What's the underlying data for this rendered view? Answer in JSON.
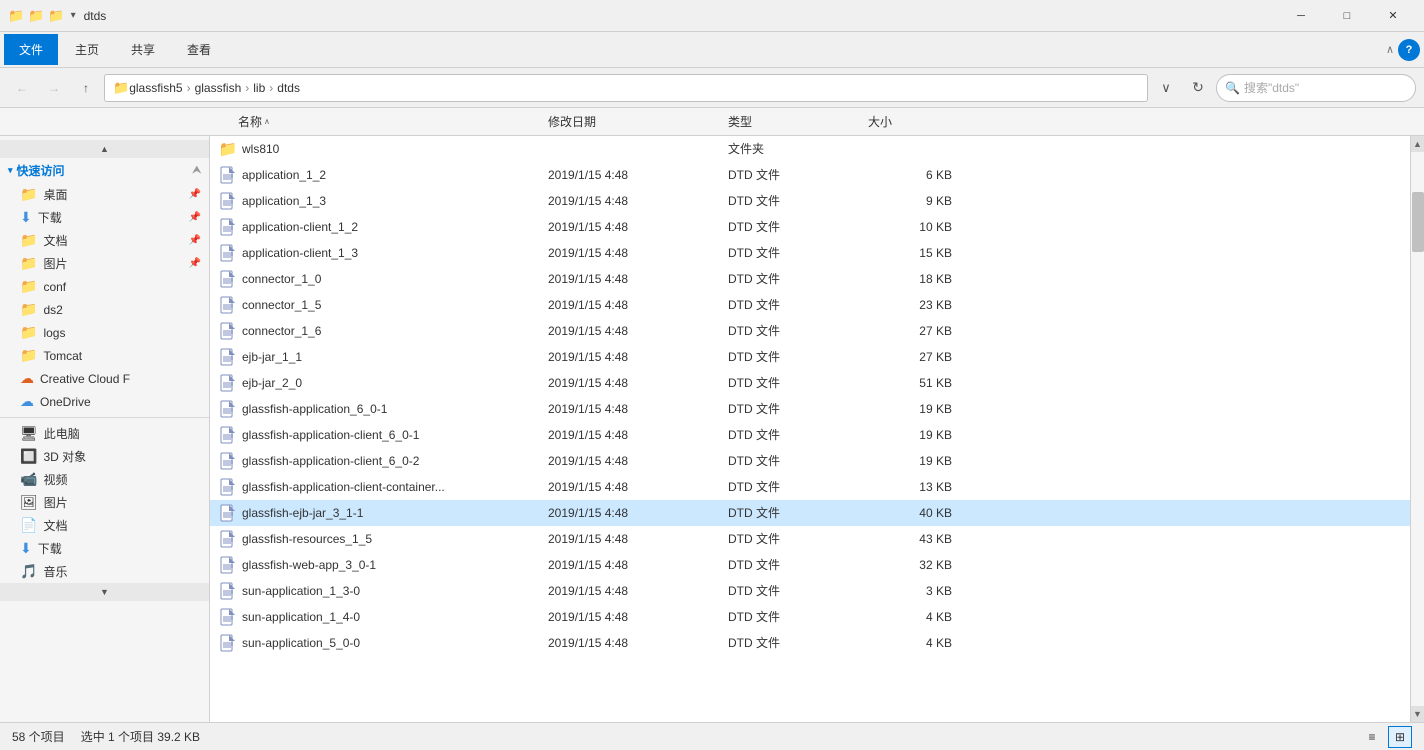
{
  "titlebar": {
    "title": "dtds",
    "icons": [
      "folder-yellow",
      "folder-blue",
      "folder-yellow"
    ],
    "min_label": "─",
    "max_label": "□",
    "close_label": "✕"
  },
  "ribbon": {
    "tabs": [
      "文件",
      "主页",
      "共享",
      "查看"
    ],
    "active_tab": "文件"
  },
  "addressbar": {
    "back_disabled": true,
    "forward_disabled": true,
    "up_label": "↑",
    "breadcrumbs": [
      "glassfish5",
      "glassfish",
      "lib",
      "dtds"
    ],
    "search_placeholder": "搜索\"dtds\"",
    "chevron_down": "∨",
    "refresh_label": "⟳"
  },
  "columns": {
    "name": "名称",
    "date": "修改日期",
    "type": "类型",
    "size": "大小",
    "sort_arrow": "∧"
  },
  "sidebar": {
    "quick_access_label": "快速访问",
    "items": [
      {
        "label": "桌面",
        "icon": "📁",
        "pinned": true
      },
      {
        "label": "下载",
        "icon": "📥",
        "pinned": true
      },
      {
        "label": "文档",
        "icon": "📁",
        "pinned": true
      },
      {
        "label": "图片",
        "icon": "📁",
        "pinned": true
      },
      {
        "label": "conf",
        "icon": "📁",
        "pinned": false
      },
      {
        "label": "ds2",
        "icon": "📁",
        "pinned": false
      },
      {
        "label": "logs",
        "icon": "📁",
        "pinned": false
      },
      {
        "label": "Tomcat",
        "icon": "📁",
        "pinned": false
      },
      {
        "label": "Creative Cloud F",
        "icon": "☁",
        "pinned": false,
        "color": "orange"
      },
      {
        "label": "OneDrive",
        "icon": "☁",
        "pinned": false,
        "color": "blue"
      },
      {
        "label": "此电脑",
        "icon": "💻",
        "pinned": false
      },
      {
        "label": "3D 对象",
        "icon": "🔲",
        "pinned": false
      },
      {
        "label": "视频",
        "icon": "📹",
        "pinned": false
      },
      {
        "label": "图片",
        "icon": "🖼",
        "pinned": false
      },
      {
        "label": "文档",
        "icon": "📄",
        "pinned": false
      },
      {
        "label": "下载",
        "icon": "📥",
        "pinned": false
      },
      {
        "label": "音乐",
        "icon": "🎵",
        "pinned": false
      }
    ]
  },
  "files": [
    {
      "name": "wls810",
      "date": "",
      "type": "文件夹",
      "size": "",
      "is_folder": true,
      "selected": false
    },
    {
      "name": "application_1_2",
      "date": "2019/1/15 4:48",
      "type": "DTD 文件",
      "size": "6 KB",
      "is_folder": false,
      "selected": false
    },
    {
      "name": "application_1_3",
      "date": "2019/1/15 4:48",
      "type": "DTD 文件",
      "size": "9 KB",
      "is_folder": false,
      "selected": false
    },
    {
      "name": "application-client_1_2",
      "date": "2019/1/15 4:48",
      "type": "DTD 文件",
      "size": "10 KB",
      "is_folder": false,
      "selected": false
    },
    {
      "name": "application-client_1_3",
      "date": "2019/1/15 4:48",
      "type": "DTD 文件",
      "size": "15 KB",
      "is_folder": false,
      "selected": false
    },
    {
      "name": "connector_1_0",
      "date": "2019/1/15 4:48",
      "type": "DTD 文件",
      "size": "18 KB",
      "is_folder": false,
      "selected": false
    },
    {
      "name": "connector_1_5",
      "date": "2019/1/15 4:48",
      "type": "DTD 文件",
      "size": "23 KB",
      "is_folder": false,
      "selected": false
    },
    {
      "name": "connector_1_6",
      "date": "2019/1/15 4:48",
      "type": "DTD 文件",
      "size": "27 KB",
      "is_folder": false,
      "selected": false
    },
    {
      "name": "ejb-jar_1_1",
      "date": "2019/1/15 4:48",
      "type": "DTD 文件",
      "size": "27 KB",
      "is_folder": false,
      "selected": false
    },
    {
      "name": "ejb-jar_2_0",
      "date": "2019/1/15 4:48",
      "type": "DTD 文件",
      "size": "51 KB",
      "is_folder": false,
      "selected": false
    },
    {
      "name": "glassfish-application_6_0-1",
      "date": "2019/1/15 4:48",
      "type": "DTD 文件",
      "size": "19 KB",
      "is_folder": false,
      "selected": false
    },
    {
      "name": "glassfish-application-client_6_0-1",
      "date": "2019/1/15 4:48",
      "type": "DTD 文件",
      "size": "19 KB",
      "is_folder": false,
      "selected": false
    },
    {
      "name": "glassfish-application-client_6_0-2",
      "date": "2019/1/15 4:48",
      "type": "DTD 文件",
      "size": "19 KB",
      "is_folder": false,
      "selected": false
    },
    {
      "name": "glassfish-application-client-container...",
      "date": "2019/1/15 4:48",
      "type": "DTD 文件",
      "size": "13 KB",
      "is_folder": false,
      "selected": false
    },
    {
      "name": "glassfish-ejb-jar_3_1-1",
      "date": "2019/1/15 4:48",
      "type": "DTD 文件",
      "size": "40 KB",
      "is_folder": false,
      "selected": true
    },
    {
      "name": "glassfish-resources_1_5",
      "date": "2019/1/15 4:48",
      "type": "DTD 文件",
      "size": "43 KB",
      "is_folder": false,
      "selected": false
    },
    {
      "name": "glassfish-web-app_3_0-1",
      "date": "2019/1/15 4:48",
      "type": "DTD 文件",
      "size": "32 KB",
      "is_folder": false,
      "selected": false
    },
    {
      "name": "sun-application_1_3-0",
      "date": "2019/1/15 4:48",
      "type": "DTD 文件",
      "size": "3 KB",
      "is_folder": false,
      "selected": false
    },
    {
      "name": "sun-application_1_4-0",
      "date": "2019/1/15 4:48",
      "type": "DTD 文件",
      "size": "4 KB",
      "is_folder": false,
      "selected": false
    },
    {
      "name": "sun-application_5_0-0",
      "date": "2019/1/15 4:48",
      "type": "DTD 文件",
      "size": "4 KB",
      "is_folder": false,
      "selected": false
    }
  ],
  "statusbar": {
    "count_label": "58 个项目",
    "selected_label": "选中 1 个项目  39.2 KB",
    "view_list_icon": "≡",
    "view_grid_icon": "⊞"
  },
  "colors": {
    "accent": "#0078d7",
    "folder": "#f0c040",
    "selected_bg": "#cce8ff",
    "hover_bg": "#e8f4fd",
    "dtd_icon": "#6080c0"
  }
}
